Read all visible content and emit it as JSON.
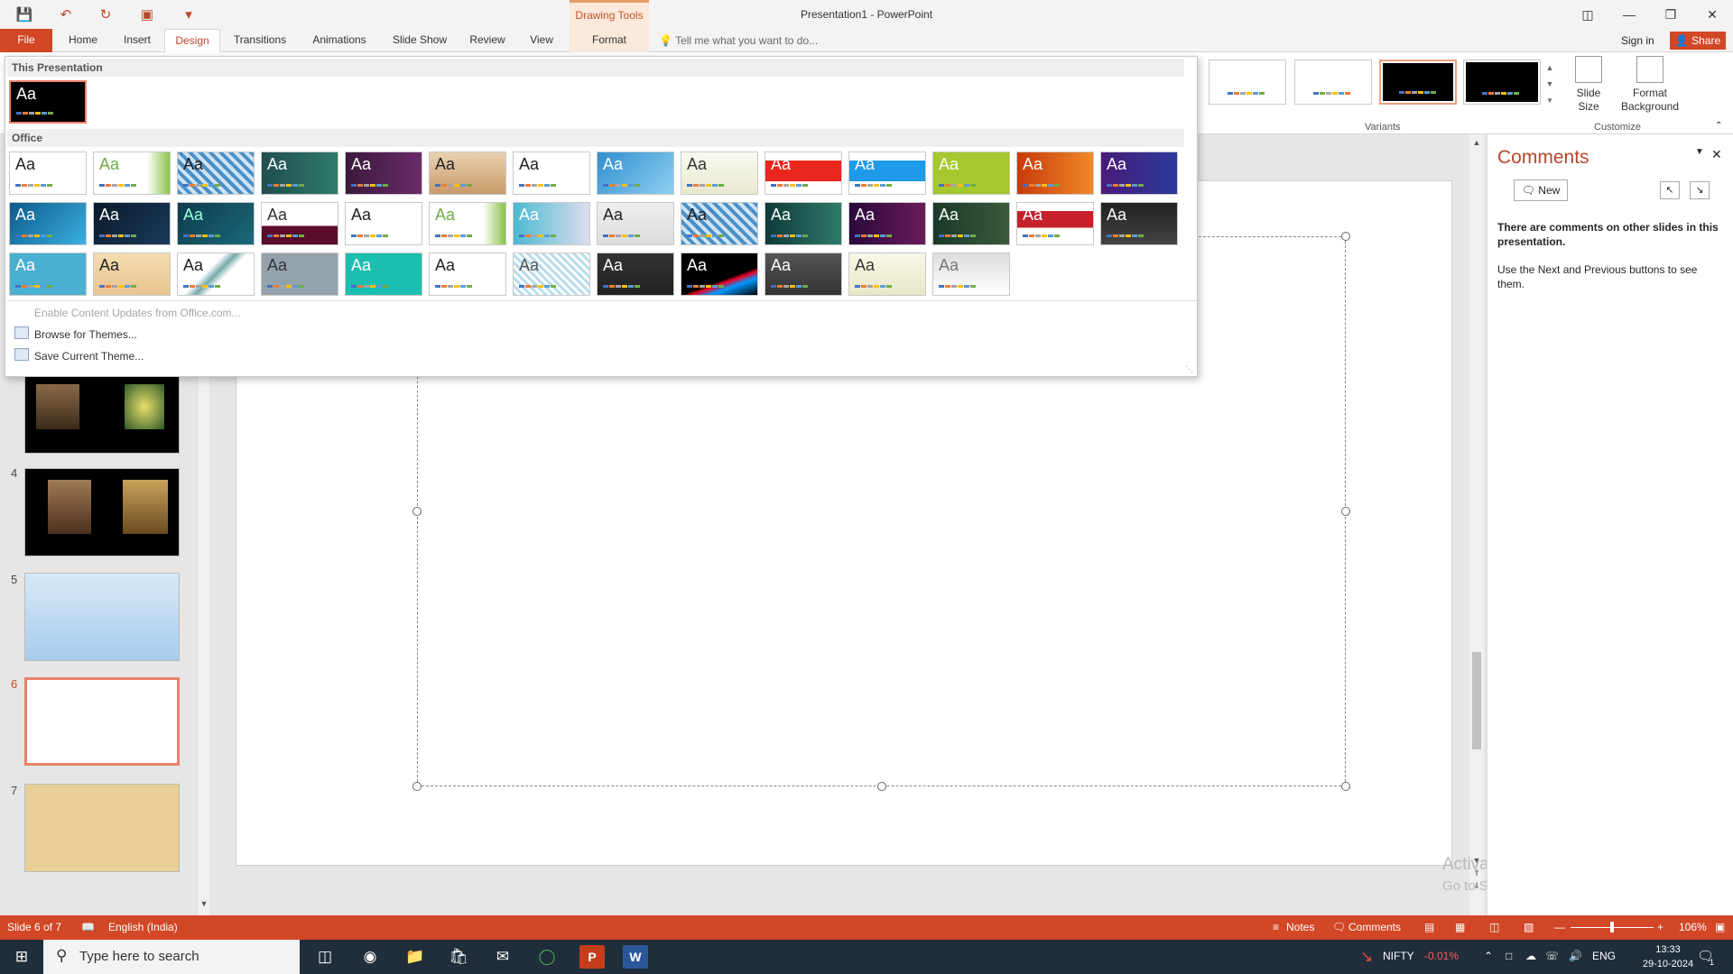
{
  "window": {
    "title": "Presentation1 - PowerPoint",
    "contextual_group": "Drawing Tools"
  },
  "tabs": [
    {
      "label": "File"
    },
    {
      "label": "Home"
    },
    {
      "label": "Insert"
    },
    {
      "label": "Design",
      "active": true
    },
    {
      "label": "Transitions"
    },
    {
      "label": "Animations"
    },
    {
      "label": "Slide Show"
    },
    {
      "label": "Review"
    },
    {
      "label": "View"
    },
    {
      "label": "Format",
      "contextual": true
    }
  ],
  "tell_me": "Tell me what you want to do...",
  "sign_in": "Sign in",
  "share": "Share",
  "ribbon": {
    "variants_label": "Variants",
    "customize_label": "Customize",
    "slide_size_label": "Slide Size",
    "format_background_label": "Format Background"
  },
  "gallery": {
    "section_this": "This Presentation",
    "section_office": "Office",
    "theme_sample_text": "Aa",
    "menu": {
      "enable_updates": "Enable Content Updates from Office.com...",
      "browse": "Browse for Themes...",
      "save": "Save Current Theme..."
    }
  },
  "thumbnails": [
    {
      "number": "4"
    },
    {
      "number": "5"
    },
    {
      "number": "6",
      "selected": true
    },
    {
      "number": "7"
    }
  ],
  "comments": {
    "title": "Comments",
    "new_label": "New",
    "message_bold": "There are comments on other slides in this presentation.",
    "message": "Use the Next and Previous buttons to see them."
  },
  "watermark": {
    "line1": "Activate Windows",
    "line2": "Go to Settings to activate Windows."
  },
  "status": {
    "slide": "Slide 6 of 7",
    "language": "English (India)",
    "notes": "Notes",
    "comments": "Comments",
    "zoom": "106%"
  },
  "taskbar": {
    "search_placeholder": "Type here to search",
    "stock_name": "NIFTY",
    "stock_change": "-0.01%",
    "language": "ENG",
    "time": "13:33",
    "date": "29-10-2024",
    "notification_count": "1"
  },
  "colors": {
    "accent": "#d24726",
    "accent_text": "#b7472a",
    "negative": "#ff5b5b"
  }
}
